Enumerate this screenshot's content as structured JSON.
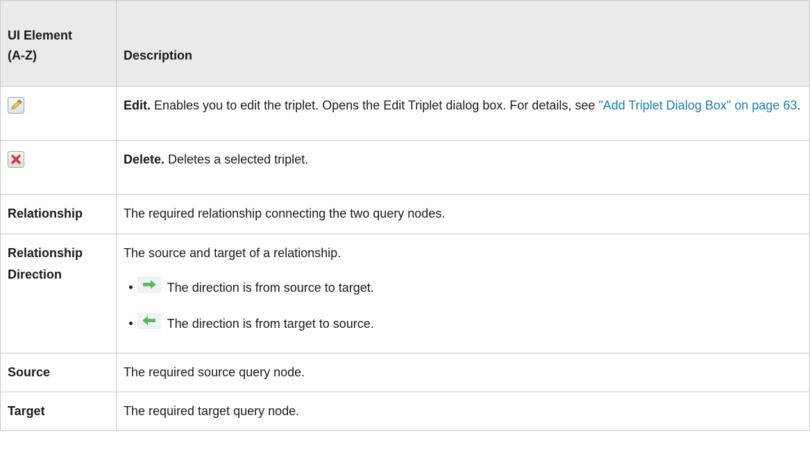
{
  "header": {
    "col1": "UI Element (A-Z)",
    "col1_line1": "UI Element",
    "col1_line2": "(A-Z)",
    "col2": "Description"
  },
  "rows": {
    "edit": {
      "icon": "pencil-icon",
      "lead": "Edit.",
      "text": " Enables you to edit the triplet. Opens the Edit Triplet dialog box. For details, see ",
      "link": "\"Add Triplet Dialog Box\" on page 63",
      "tail": "."
    },
    "delete": {
      "icon": "delete-x-icon",
      "lead": "Delete.",
      "text": " Deletes a selected triplet."
    },
    "relationship": {
      "name": "Relationship",
      "text": "The required relationship connecting the two query nodes."
    },
    "direction": {
      "name_line1": "Relationship",
      "name_line2": "Direction",
      "text": "The source and target of a relationship.",
      "bullets": [
        {
          "icon": "arrow-right-icon",
          "text": " The direction is from source to target."
        },
        {
          "icon": "arrow-left-icon",
          "text": " The direction is from target to source."
        }
      ]
    },
    "source": {
      "name": "Source",
      "text": "The required source query node."
    },
    "target": {
      "name": "Target",
      "text": "The required target query node."
    }
  },
  "colors": {
    "header_bg": "#eaeaea",
    "border": "#c8c8c8",
    "link": "#1a7db6",
    "arrow_green": "#5cb85c"
  }
}
